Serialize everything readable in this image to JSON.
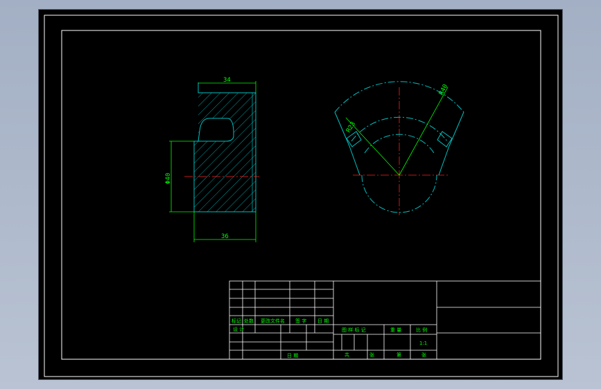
{
  "drawing": {
    "dimensions": {
      "top_width": "34",
      "bore_diameter": "Φ40",
      "bottom_width": "36",
      "outer_radius": "R40",
      "inner_radius": "R23"
    },
    "title_block": {
      "col_marks": "标记",
      "col_count": "处数",
      "col_change_doc": "更改文件名",
      "col_signature": "签 字",
      "col_date": "日 期",
      "row_design": "设 计",
      "row_date": "日 期",
      "stage_mark": "图 样 标 记",
      "weight": "重 量",
      "scale": "比 例",
      "scale_value": "1:1",
      "total": "共",
      "sheet": "张",
      "page": "第",
      "sheet2": "张"
    },
    "colors": {
      "frame": "#ffffff",
      "dimension": "#00ff00",
      "section": "#00c0c0",
      "centerline": "#ff2020",
      "hatch": "#00b0b0"
    }
  }
}
